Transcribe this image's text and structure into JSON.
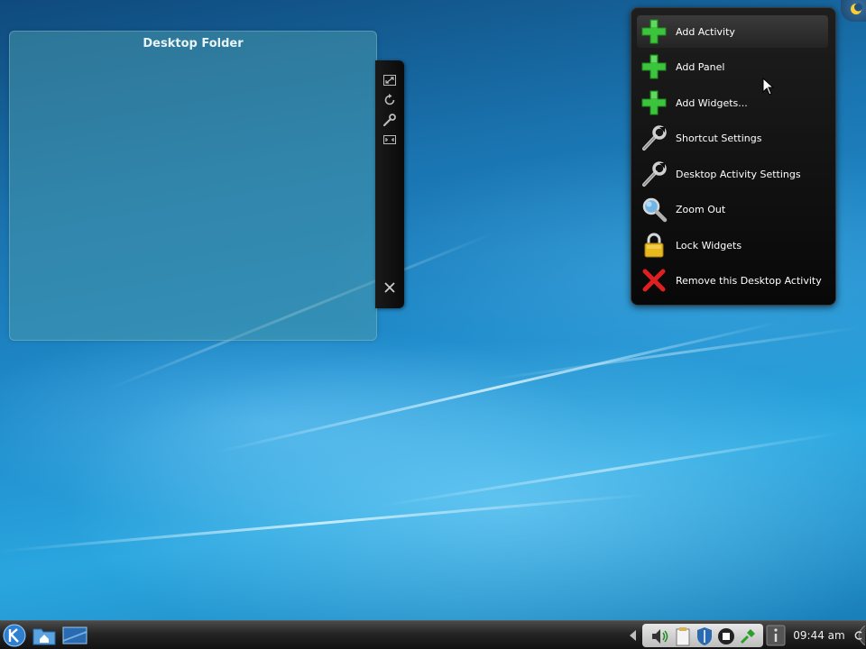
{
  "desktop_folder": {
    "title": "Desktop Folder"
  },
  "widget_handle": {
    "buttons": [
      {
        "icon": "resize-icon"
      },
      {
        "icon": "rotate-icon"
      },
      {
        "icon": "wrench-icon"
      },
      {
        "icon": "maximize-icon"
      },
      {
        "icon": "close-icon"
      }
    ]
  },
  "context_menu": {
    "items": [
      {
        "label": "Add Activity",
        "icon": "green-plus-icon",
        "highlighted": true
      },
      {
        "label": "Add Panel",
        "icon": "green-plus-icon"
      },
      {
        "label": "Add Widgets...",
        "icon": "green-plus-icon"
      },
      {
        "label": "Shortcut Settings",
        "icon": "wrench-icon"
      },
      {
        "label": "Desktop Activity Settings",
        "icon": "wrench-icon"
      },
      {
        "label": "Zoom Out",
        "icon": "magnifier-icon"
      },
      {
        "label": "Lock Widgets",
        "icon": "padlock-icon"
      },
      {
        "label": "Remove this Desktop Activity",
        "icon": "red-x-icon"
      }
    ]
  },
  "taskbar": {
    "clock": "09:44 am"
  },
  "colors": {
    "menu_bg": "#0b0b0b",
    "plus_green": "#3cc43c",
    "remove_red": "#e02020",
    "lock_gold": "#e8b820"
  }
}
